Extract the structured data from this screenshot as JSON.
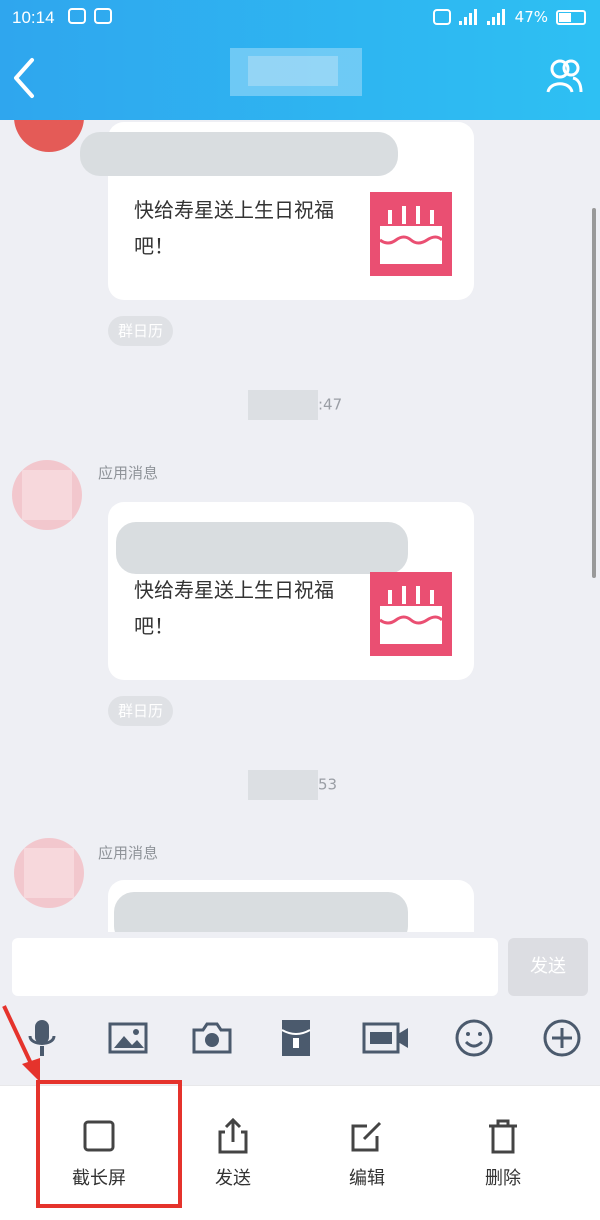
{
  "status": {
    "time": "10:14",
    "battery_text": "47%"
  },
  "header": {
    "back_icon": "chevron-left-icon",
    "contact_icon": "contact-icon"
  },
  "messages": [
    {
      "sender": "",
      "text": "快给寿星送上生日祝福吧！",
      "tag": "群日历",
      "time": "",
      "icon": "cake-icon"
    },
    {
      "sender": "应用消息",
      "text": "快给寿星送上生日祝福吧！",
      "tag": "群日历",
      "time_suffix": ":47",
      "icon": "cake-icon"
    },
    {
      "sender": "应用消息",
      "time_suffix": "53"
    }
  ],
  "input": {
    "value": "",
    "placeholder": "",
    "send_label": "发送"
  },
  "tools": [
    {
      "icon": "microphone-icon"
    },
    {
      "icon": "image-icon"
    },
    {
      "icon": "camera-icon"
    },
    {
      "icon": "red-packet-icon"
    },
    {
      "icon": "gif-icon"
    },
    {
      "icon": "emoji-icon"
    },
    {
      "icon": "plus-icon"
    }
  ],
  "actions": [
    {
      "label": "截长屏",
      "icon": "square-icon"
    },
    {
      "label": "发送",
      "icon": "share-icon"
    },
    {
      "label": "编辑",
      "icon": "edit-icon"
    },
    {
      "label": "删除",
      "icon": "trash-icon"
    }
  ],
  "colors": {
    "header_start": "#2fa6ee",
    "header_end": "#2ec0f3",
    "highlight": "#e5332c",
    "cake": "#ea4f72"
  }
}
